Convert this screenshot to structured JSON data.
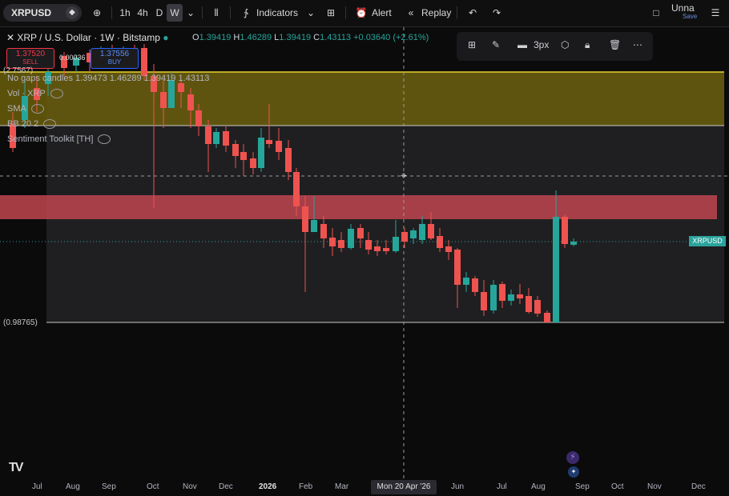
{
  "toolbar": {
    "symbol": "XRPUSD",
    "intervals": [
      "1h",
      "4h",
      "D",
      "W"
    ],
    "active_interval": "W",
    "indicators_label": "Indicators",
    "alert_label": "Alert",
    "replay_label": "Replay",
    "unnamed_label": "Unna",
    "saved_label": "Save"
  },
  "legend": {
    "title": "XRP / U.S. Dollar · 1W · Bitstamp",
    "o_label": "O",
    "o_value": "1.39419",
    "h_label": "H",
    "h_value": "1.46289",
    "l_label": "L",
    "l_value": "1.39419",
    "c_label": "C",
    "c_value": "1.43113",
    "change": "+0.03640 (+2.61%)",
    "sell_price": "1.37520",
    "sell_label": "SELL",
    "buy_price": "1.37556",
    "buy_label": "BUY",
    "spread": "0.00036",
    "indicators": [
      {
        "label": "No gaps candles  1.39473  1.46289  1.39419  1.43113"
      },
      {
        "label": "Vol · XRP"
      },
      {
        "label": "SMA"
      },
      {
        "label": "BB 20 2"
      },
      {
        "label": "Sentiment Toolkit [TH]"
      }
    ]
  },
  "drawing_toolbar": {
    "width_label": "3px"
  },
  "price_axis": {
    "current_tag": "XRPUSD",
    "upper_label": "(2.7567)",
    "lower_label": "(0.98765)"
  },
  "time_axis": {
    "labels": [
      "Jul",
      "Aug",
      "Sep",
      "Oct",
      "Nov",
      "Dec",
      "2026",
      "Feb",
      "Mar",
      "Jun",
      "Jul",
      "Aug",
      "Sep",
      "Oct",
      "Nov",
      "Dec"
    ],
    "crosshair_label": "Mon 20 Apr '26"
  },
  "colors": {
    "up": "#26a69a",
    "down": "#ef5350",
    "supply_zone": "#8c7a10",
    "resistance_zone": "#c0454f"
  },
  "chart_data": {
    "type": "candlestick",
    "symbol": "XRPUSD",
    "interval": "1W",
    "ohlc_last": {
      "open": 1.39419,
      "high": 1.46289,
      "low": 1.39419,
      "close": 1.43113
    },
    "zones": [
      {
        "type": "yellow-band"
      },
      {
        "type": "red-band"
      }
    ]
  }
}
